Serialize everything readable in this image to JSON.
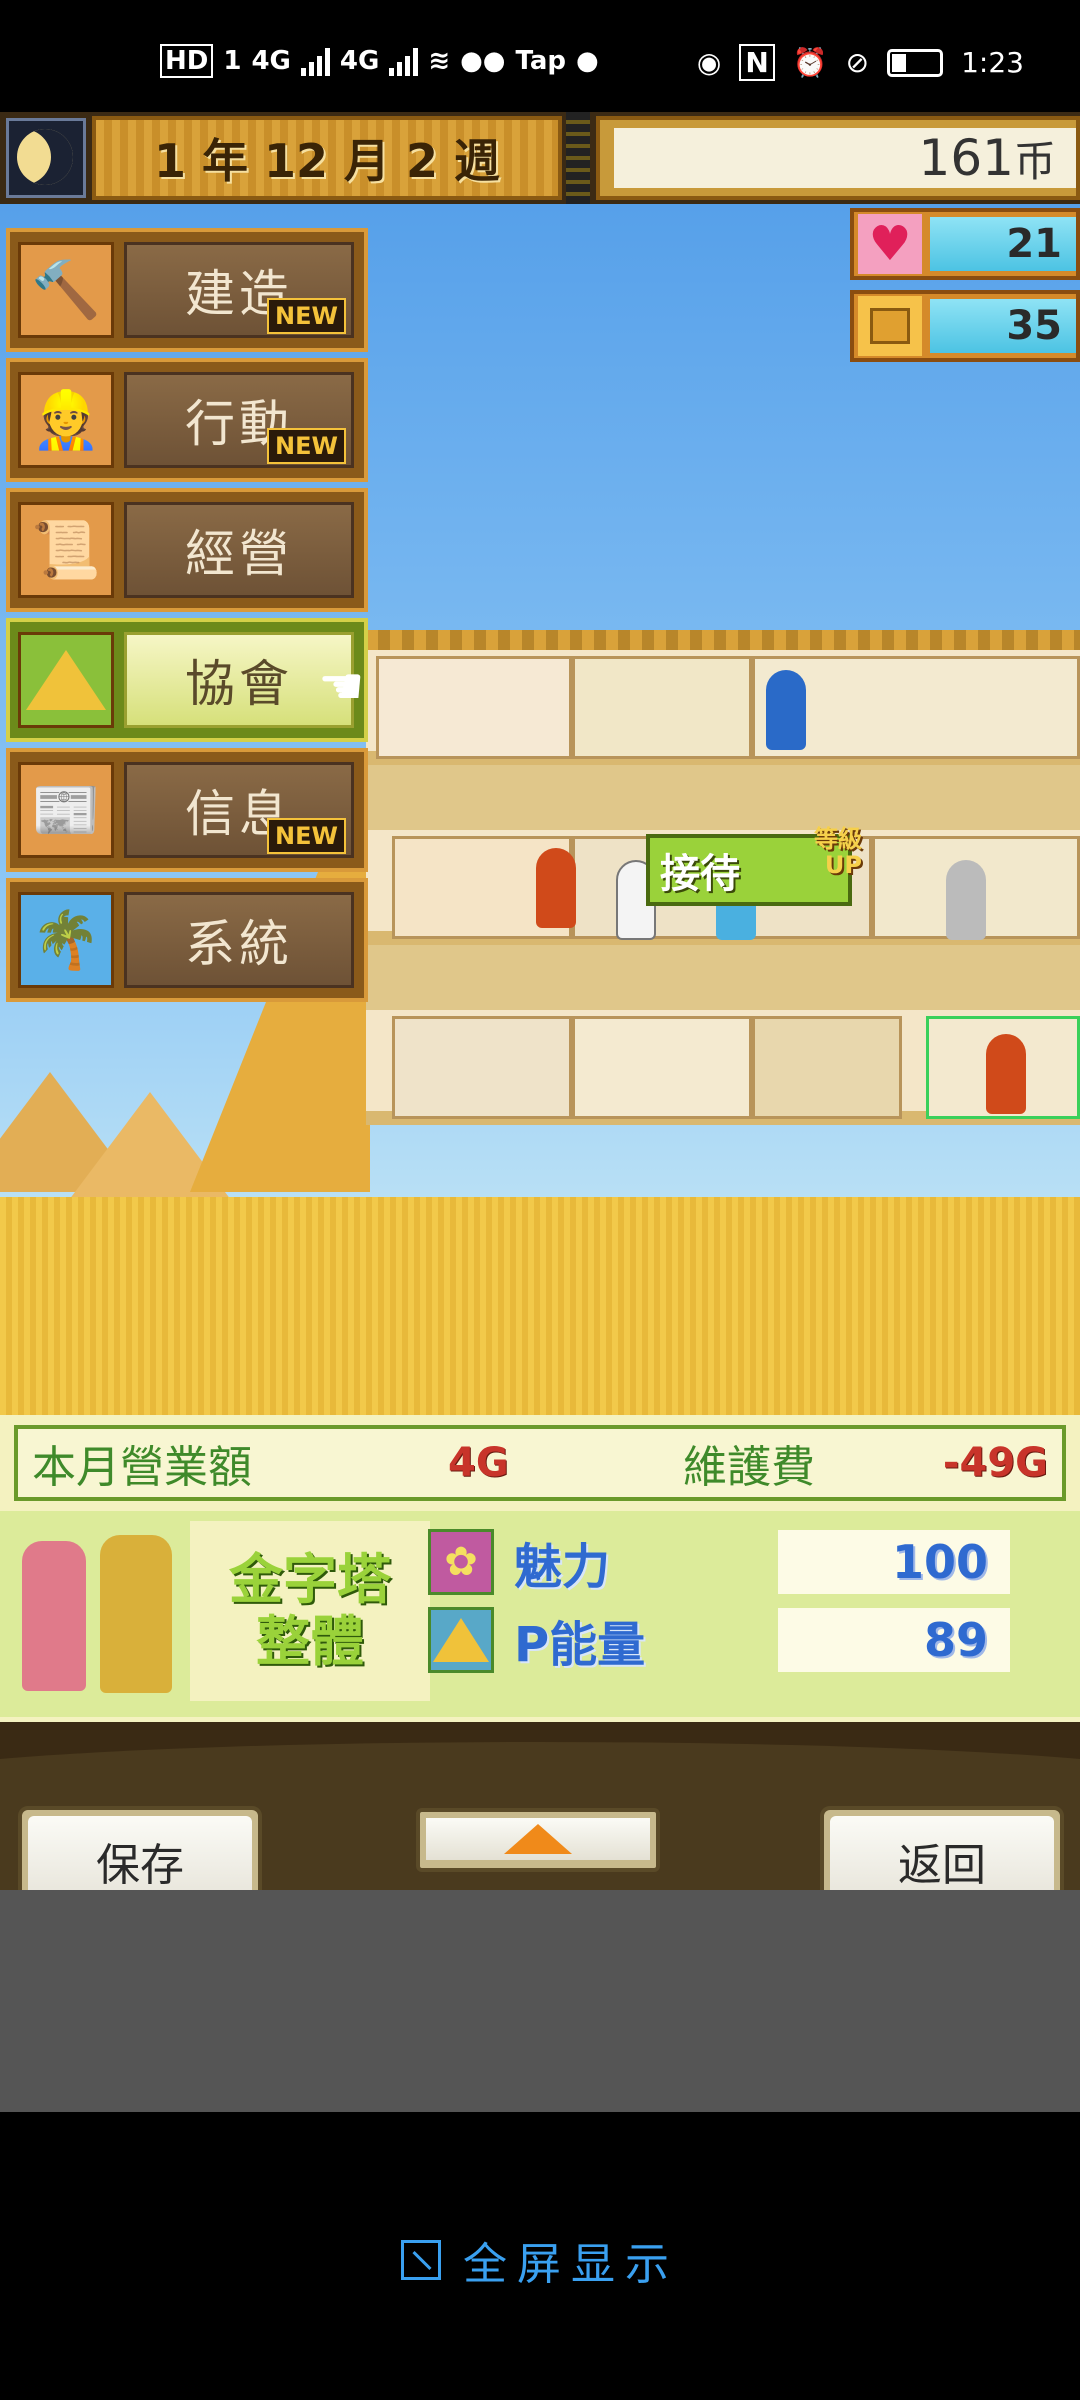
{
  "status_bar": {
    "left_labels": [
      "HD",
      "1",
      "4G",
      "4G",
      "Tap"
    ],
    "time": "1:23"
  },
  "top": {
    "date": "1 年 12 月 2 週",
    "coins_value": "161",
    "coins_unit": "币"
  },
  "stats": {
    "hearts": "21",
    "stone": "35"
  },
  "menu": {
    "items": [
      {
        "label": "建造",
        "badge": "NEW",
        "icon": "hammer-icon"
      },
      {
        "label": "行動",
        "badge": "NEW",
        "icon": "worker-icon"
      },
      {
        "label": "經營",
        "badge": "",
        "icon": "scroll-icon"
      },
      {
        "label": "協會",
        "badge": "",
        "icon": "pyramid-icon"
      },
      {
        "label": "信息",
        "badge": "NEW",
        "icon": "paper-icon"
      },
      {
        "label": "系統",
        "badge": "",
        "icon": "oasis-icon"
      }
    ]
  },
  "bubble": {
    "main": "接待",
    "sub1": "等級",
    "sub2": "UP"
  },
  "info": {
    "income_label": "本月營業額",
    "income_value": "4G",
    "maint_label": "維護費",
    "maint_value": "-49G",
    "pyramid_name_1": "金字塔",
    "pyramid_name_2": "整體",
    "charm_label": "魅力",
    "charm_value": "100",
    "energy_label": "P能量",
    "energy_value": "89"
  },
  "buttons": {
    "save": "保存",
    "back": "返回"
  },
  "footer": {
    "fullscreen": "全屏显示"
  },
  "colors": {
    "accent_green": "#9ad23a",
    "negative_red": "#c8342a",
    "stat_blue": "#2f6ad0",
    "fullscreen_blue": "#3aa0f0"
  }
}
